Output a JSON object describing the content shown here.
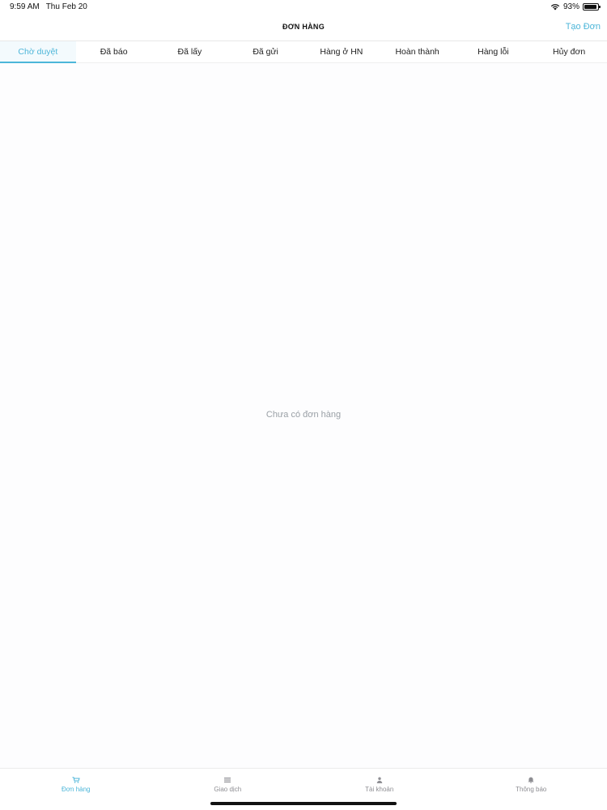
{
  "status_bar": {
    "time": "9:59 AM",
    "date": "Thu Feb 20",
    "battery_text": "93%",
    "battery_level": 0.93
  },
  "header": {
    "title": "ĐƠN HÀNG",
    "action_label": "Tạo Đơn"
  },
  "tabs": [
    {
      "label": "Chờ duyệt",
      "active": true
    },
    {
      "label": "Đã báo",
      "active": false
    },
    {
      "label": "Đã lấy",
      "active": false
    },
    {
      "label": "Đã gửi",
      "active": false
    },
    {
      "label": "Hàng ở HN",
      "active": false
    },
    {
      "label": "Hoàn thành",
      "active": false
    },
    {
      "label": "Hàng lỗi",
      "active": false
    },
    {
      "label": "Hủy đơn",
      "active": false
    }
  ],
  "content": {
    "empty_message": "Chưa có đơn hàng"
  },
  "bottom_nav": [
    {
      "label": "Đơn hàng",
      "icon": "cart-icon",
      "active": true
    },
    {
      "label": "Giao dịch",
      "icon": "list-icon",
      "active": false
    },
    {
      "label": "Tài khoản",
      "icon": "user-icon",
      "active": false
    },
    {
      "label": "Thông báo",
      "icon": "bell-icon",
      "active": false
    }
  ],
  "colors": {
    "accent": "#4db6d9",
    "inactive": "#8e8e93",
    "empty_text": "#9aa0a6"
  }
}
